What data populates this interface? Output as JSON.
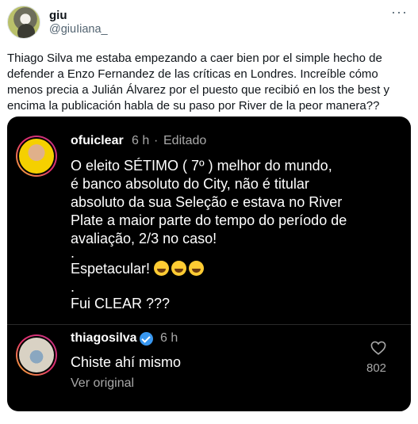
{
  "author": {
    "display_name": "giu",
    "handle": "@giuIiana_"
  },
  "more_icon": "···",
  "tweet_text": "Thiago Silva me estaba empezando a caer bien por el simple hecho de defender a Enzo Fernandez de las críticas en Londres. Increíble cómo menos precia a Julián Álvarez por el puesto que recibió en los the best y encima la publicación habla de su paso por River de la peor manera??",
  "quoted_post": {
    "comment": {
      "username": "ofuiclear",
      "time": "6 h",
      "separator": "·",
      "edited": "Editado",
      "lines": [
        "O eleito SÉTIMO ( 7º ) melhor do mundo,",
        "é banco absoluto do City, não é titular",
        "absoluto da sua Seleção e estava no River",
        "Plate a maior parte do tempo do período de",
        "avaliação, 2/3 no caso!",
        ".",
        "Espetacular!",
        ".",
        "Fui CLEAR ???"
      ]
    },
    "reply": {
      "username": "thiagosilva",
      "time": "6 h",
      "text": "Chiste ahí mismo",
      "link": "Ver original",
      "likes": "802"
    }
  },
  "colors": {
    "card_bg": "#000000",
    "verified": "#3897f0",
    "muted": "#a8a8a8",
    "handle": "#536471"
  }
}
